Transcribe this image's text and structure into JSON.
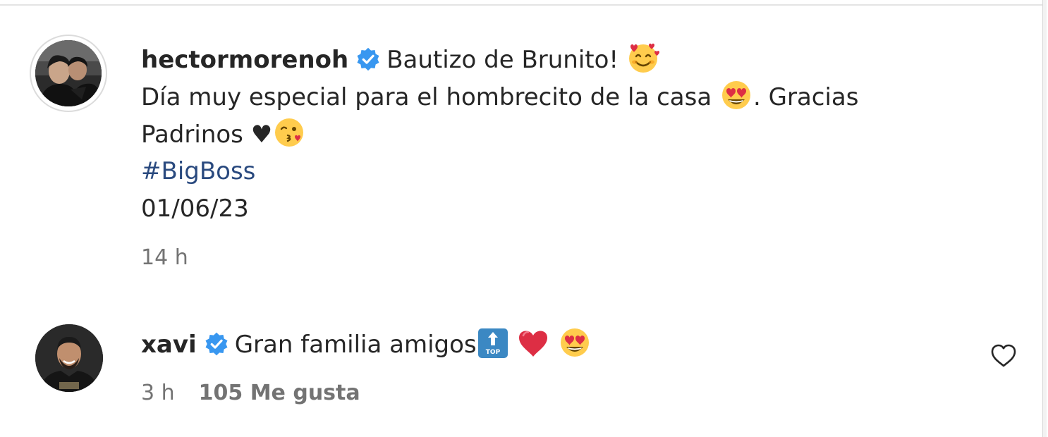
{
  "caption": {
    "username": "hectormorenoh",
    "title_text": "Bautizo de Brunito!",
    "line2_text": "Día muy especial para el hombrecito de la casa",
    "line2_tail": ". Gracias",
    "line3_text": "Padrinos ♥",
    "hashtag": "#BigBoss",
    "date": "01/06/23",
    "time_ago": "14 h",
    "emojis": [
      "smiling-face-with-hearts-icon",
      "heart-eyes-icon",
      "face-blowing-kiss-icon"
    ]
  },
  "comment": {
    "username": "xavi",
    "text": "Gran familia amigos",
    "emojis": [
      "top-arrow-icon",
      "red-heart-icon",
      "heart-eyes-icon"
    ],
    "time_ago": "3 h",
    "likes": "105 Me gusta"
  },
  "colors": {
    "verified_blue": "#3897f0",
    "hashtag": "#2a4a7f",
    "meta_gray": "#737373",
    "emoji_yellow": "#ffcc4d",
    "heart_red": "#dd2e44",
    "top_blue": "#3b88c3"
  }
}
